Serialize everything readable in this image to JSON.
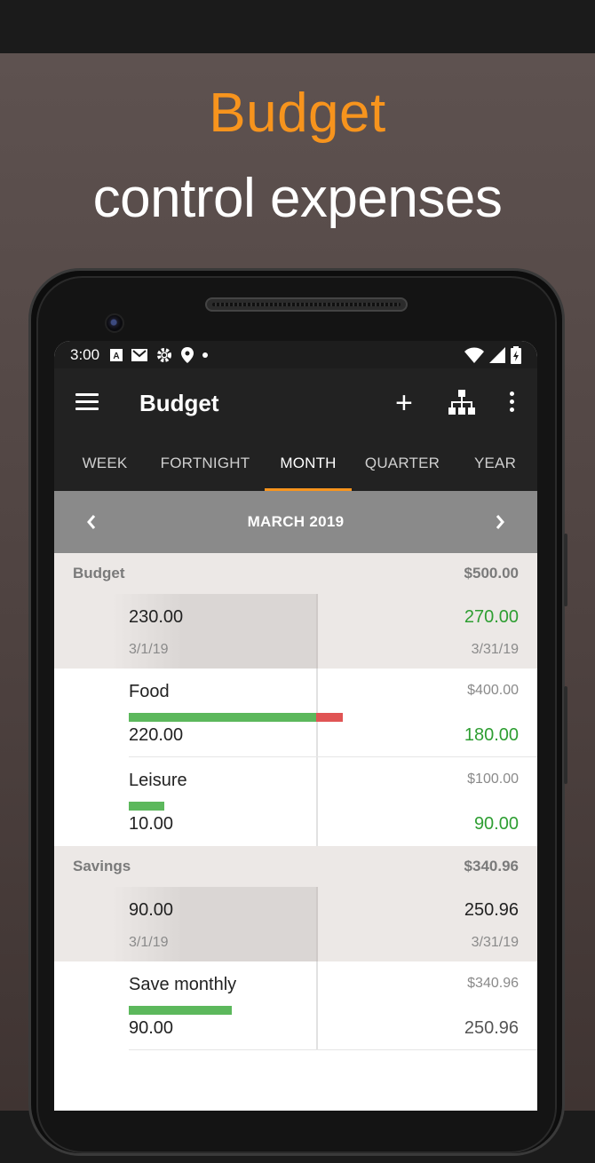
{
  "promo": {
    "title": "Budget",
    "subtitle": "control expenses"
  },
  "status_bar": {
    "time": "3:00",
    "icons": [
      "a-icon",
      "mail-icon",
      "settings-icon",
      "location-icon",
      "dot-icon"
    ],
    "right_icons": [
      "wifi-icon",
      "signal-icon",
      "battery-icon"
    ]
  },
  "app_bar": {
    "title": "Budget"
  },
  "tabs": [
    {
      "label": "WEEK",
      "active": false
    },
    {
      "label": "FORTNIGHT",
      "active": false
    },
    {
      "label": "MONTH",
      "active": true
    },
    {
      "label": "QUARTER",
      "active": false
    },
    {
      "label": "YEAR",
      "active": false
    }
  ],
  "period": {
    "label": "MARCH 2019"
  },
  "sections": [
    {
      "name": "Budget",
      "total": "$500.00",
      "summary": {
        "spent": "230.00",
        "remaining": "270.00",
        "start_date": "3/1/19",
        "end_date": "3/31/19"
      },
      "items": [
        {
          "name": "Food",
          "budget": "$400.00",
          "spent": "220.00",
          "remaining": "180.00",
          "spent_fraction": 1.0,
          "overspend_fraction": 0.14
        },
        {
          "name": "Leisure",
          "budget": "$100.00",
          "spent": "10.00",
          "remaining": "90.00",
          "spent_fraction": 0.19,
          "overspend_fraction": 0
        }
      ]
    },
    {
      "name": "Savings",
      "total": "$340.96",
      "summary": {
        "spent": "90.00",
        "remaining": "250.96",
        "start_date": "3/1/19",
        "end_date": "3/31/19"
      },
      "items": [
        {
          "name": "Save monthly",
          "budget": "$340.96",
          "spent": "90.00",
          "remaining": "250.96",
          "spent_fraction": 0.55,
          "overspend_fraction": 0
        }
      ]
    }
  ],
  "colors": {
    "accent": "#f7941d",
    "positive": "#2e9e32",
    "bar_ok": "#5cb85c",
    "bar_over": "#e05454"
  }
}
